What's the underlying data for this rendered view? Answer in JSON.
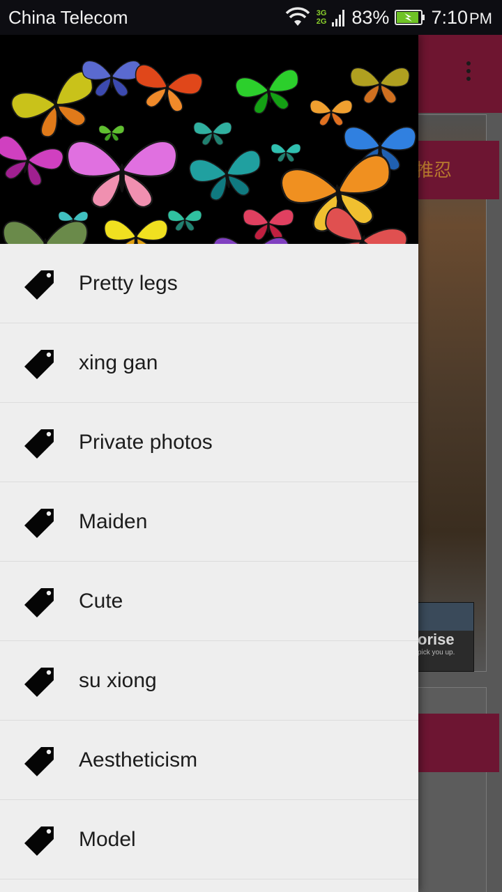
{
  "status_bar": {
    "carrier": "China Telecom",
    "network_top": "3G",
    "network_bottom": "2G",
    "battery_percent": "83%",
    "clock_time": "7:10",
    "clock_ampm": "PM",
    "icons": [
      "wifi-icon",
      "signal-icon",
      "battery-charging-icon"
    ]
  },
  "drawer": {
    "header_image": "butterflies-header-image",
    "items": [
      {
        "label": "Pretty legs",
        "icon": "tag-icon"
      },
      {
        "label": "xing gan",
        "icon": "tag-icon"
      },
      {
        "label": "Private photos",
        "icon": "tag-icon"
      },
      {
        "label": "Maiden",
        "icon": "tag-icon"
      },
      {
        "label": "Cute",
        "icon": "tag-icon"
      },
      {
        "label": "su xiong",
        "icon": "tag-icon"
      },
      {
        "label": "Aestheticism",
        "icon": "tag-icon"
      },
      {
        "label": "Model",
        "icon": "tag-icon"
      }
    ]
  },
  "background_app": {
    "toolbar_menu_icon": "overflow-menu-icon",
    "banner_text_partial": "推忍",
    "ad_text_partial": "orise",
    "ad_tagline_partial": "pick you up.",
    "colors": {
      "toolbar": "#6e1530",
      "banner": "#6d1532",
      "banner_text": "#b87a2e"
    }
  },
  "colors": {
    "drawer_bg": "#eeeeee",
    "status_bar_bg": "#0d0d12",
    "divider": "#dcdcdc",
    "text": "#1c1c1c"
  }
}
